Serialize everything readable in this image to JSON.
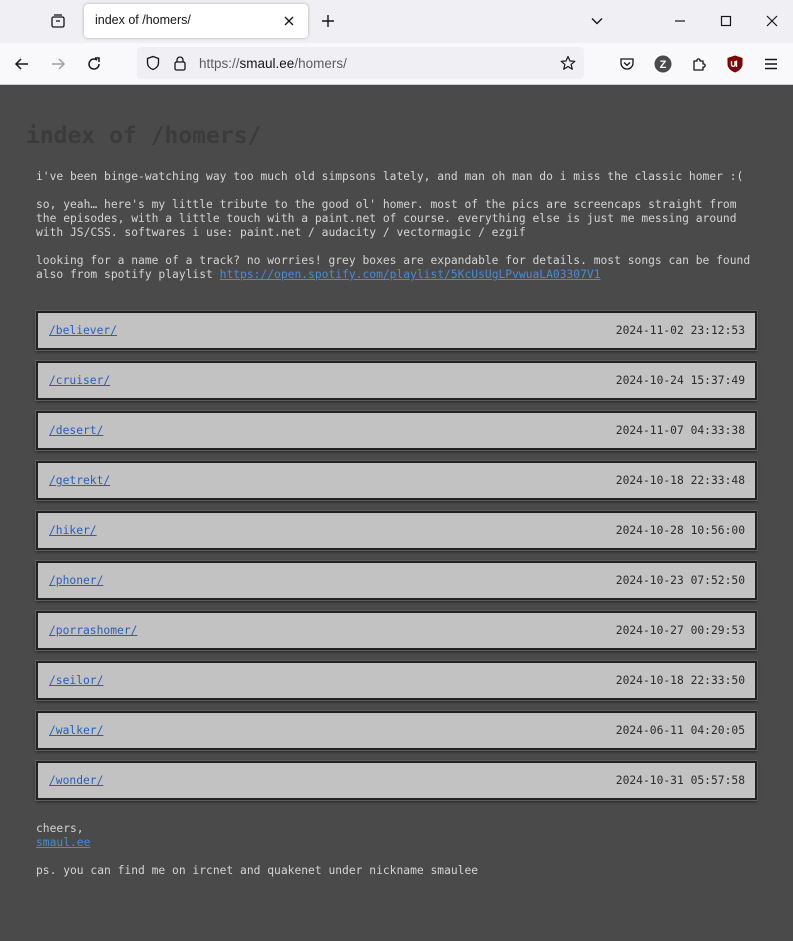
{
  "browser": {
    "tab_title": "index of /homers/",
    "url_scheme": "https://",
    "url_host": "smaul.ee",
    "url_path": "/homers/",
    "extension_badge": "Z"
  },
  "page": {
    "title": "index of /homers/",
    "intro": "i've been binge-watching way too much old simpsons lately, and man oh man do i miss the classic homer :(",
    "about_line1": "so, yeah… here's my little tribute to the good ol' homer. most of the pics are screencaps straight from",
    "about_line2": "the episodes, with a little touch with a paint.net of course. everything else is just me messing around",
    "about_line3": "with JS/CSS. softwares i use: paint.net / audacity / vectormagic / ezgif",
    "track_line1": "looking for a name of a track? no worries! grey boxes are expandable for details. most songs can be found",
    "track_line2_prefix": "also from spotify playlist ",
    "spotify_link": "https://open.spotify.com/playlist/5KcUsUgLPvwuaLA03307V1",
    "directories": [
      {
        "name": "/believer/",
        "date": "2024-11-02 23:12:53"
      },
      {
        "name": "/cruiser/",
        "date": "2024-10-24 15:37:49"
      },
      {
        "name": "/desert/",
        "date": "2024-11-07 04:33:38"
      },
      {
        "name": "/getrekt/",
        "date": "2024-10-18 22:33:48"
      },
      {
        "name": "/hiker/",
        "date": "2024-10-28 10:56:00"
      },
      {
        "name": "/phoner/",
        "date": "2024-10-23 07:52:50"
      },
      {
        "name": "/porrashomer/",
        "date": "2024-10-27 00:29:53"
      },
      {
        "name": "/seilor/",
        "date": "2024-10-18 22:33:50"
      },
      {
        "name": "/walker/",
        "date": "2024-06-11 04:20:05"
      },
      {
        "name": "/wonder/",
        "date": "2024-10-31 05:57:58"
      }
    ],
    "signoff": "cheers,",
    "signoff_link": "smaul.ee",
    "ps": "ps. you can find me on ircnet and quakenet under nickname smaulee"
  },
  "colors": {
    "page_background": "#4a4a4a",
    "box_background": "#c2c2c2",
    "link": "#2a5fb8"
  }
}
